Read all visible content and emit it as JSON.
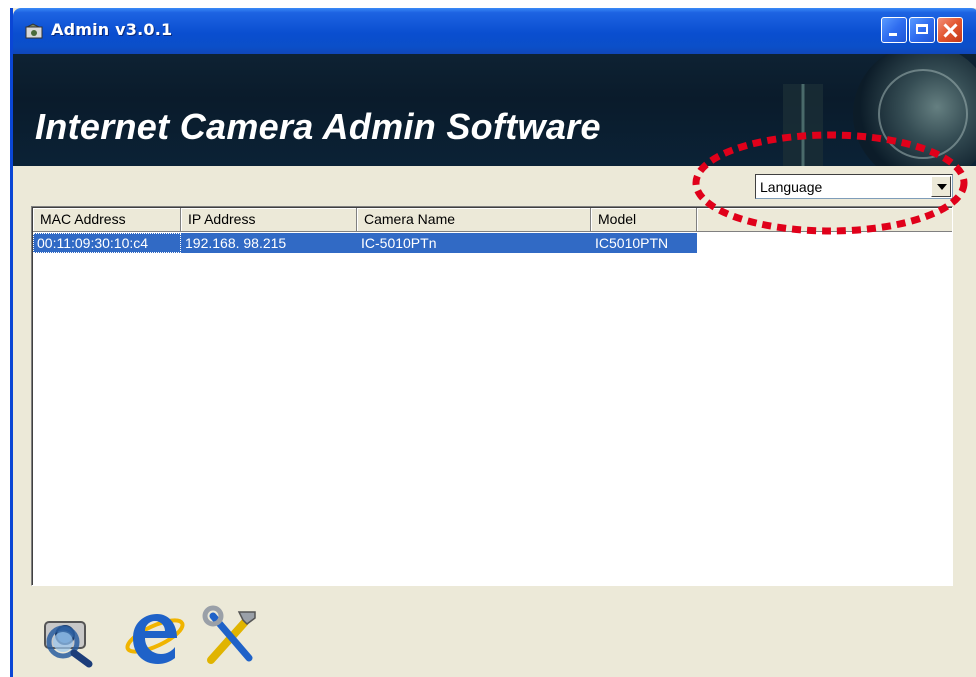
{
  "window": {
    "title": "Admin v3.0.1",
    "icon": "camera-app-icon",
    "controls": [
      "minimize-icon",
      "maximize-icon",
      "close-icon"
    ]
  },
  "banner": {
    "title": "Internet Camera Admin Software"
  },
  "language": {
    "selected": "Language"
  },
  "table": {
    "columns": [
      "MAC Address",
      "IP Address",
      "Camera Name",
      "Model"
    ],
    "rows": [
      {
        "mac": "00:11:09:30:10:c4",
        "ip": "192.168. 98.215",
        "name": "IC-5010PTn",
        "model": "IC5010PTN",
        "selected": true
      }
    ]
  },
  "toolbar": {
    "icons": [
      "search-camera-icon",
      "internet-explorer-icon",
      "tools-icon"
    ]
  },
  "colors": {
    "selection": "#316ac5",
    "titlebar": "#0a4ed0",
    "annotation": "#e0001a"
  }
}
